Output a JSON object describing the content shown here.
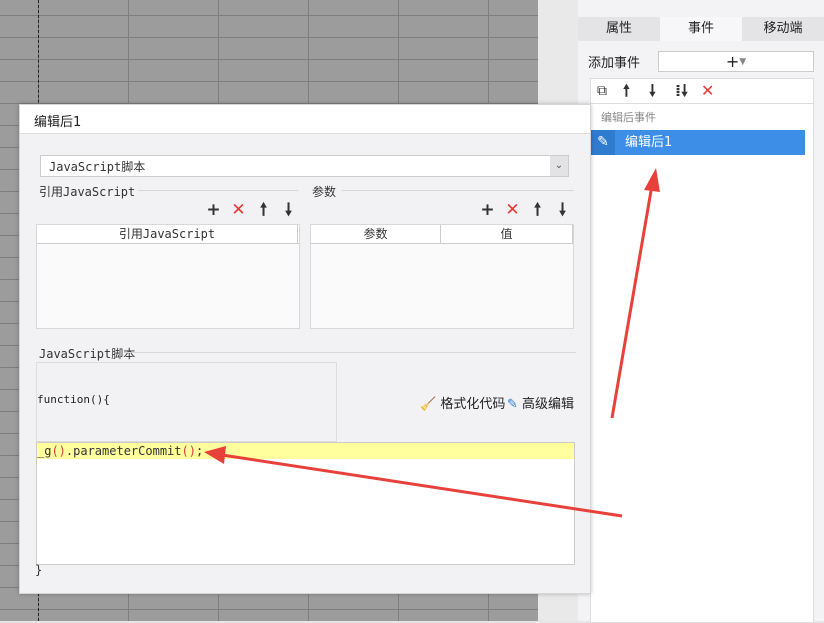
{
  "panel": {
    "tabs": [
      "属性",
      "事件",
      "移动端"
    ],
    "active_tab": 1,
    "add_event_label": "添加事件",
    "add_button": "+",
    "toolbar_icons": [
      "copy-icon",
      "arrow-up-icon",
      "arrow-down-icon",
      "move-to-bottom-icon",
      "delete-icon"
    ],
    "event_group": "编辑后事件",
    "event_item": "编辑后1"
  },
  "dialog": {
    "title": "编辑后1",
    "type_select": "JavaScript脚本",
    "ref_js_section": "引用JavaScript",
    "ref_js_column": "引用JavaScript",
    "params_section": "参数",
    "params_columns": [
      "参数",
      "值"
    ],
    "script_section": "JavaScript脚本",
    "function_open": "function(){",
    "code_prefix": "_g",
    "code_paren1": "()",
    "code_middle": ".parameterCommit",
    "code_paren2": "()",
    "code_suffix": ";",
    "function_close": "}",
    "format_button": "格式化代码",
    "advanced_button": "高级编辑"
  },
  "colors": {
    "selected_item": "#3c8ee6",
    "highlight_line": "#ffff9e",
    "arrow": "#e8403a"
  }
}
